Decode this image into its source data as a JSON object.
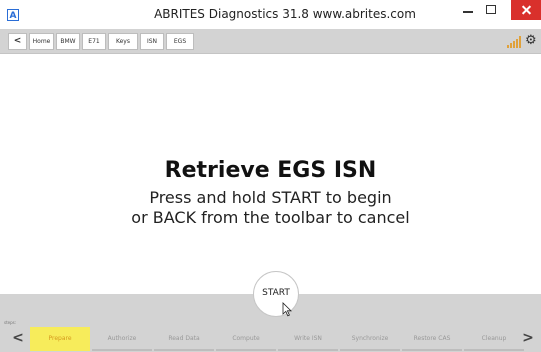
{
  "window": {
    "app_icon_letter": "A",
    "title": "ABRITES Diagnostics 31.8  www.abrites.com"
  },
  "toolbar": {
    "back_glyph": "<",
    "breadcrumbs": [
      "Home",
      "BMW",
      "E71",
      "Keys",
      "ISN",
      "EGS"
    ],
    "signal_icon": "signal-strength-icon",
    "settings_icon": "gear-icon"
  },
  "main": {
    "heading": "Retrieve EGS ISN",
    "message_line1": "Press and hold START to begin",
    "message_line2": "or BACK from the toolbar to cancel",
    "start_button": "START"
  },
  "steps": {
    "label": "steps:",
    "prev_glyph": "<",
    "next_glyph": ">",
    "items": [
      "Prepare",
      "Authorize",
      "Read Data",
      "Compute",
      "Write ISN",
      "Synchronize",
      "Restore CAS",
      "Cleanup"
    ],
    "active_index": 0
  },
  "colors": {
    "close_button": "#d9302c",
    "active_step": "#f7ec5b",
    "signal": "#e0a13a",
    "toolbar_bg": "#d3d3d3"
  }
}
